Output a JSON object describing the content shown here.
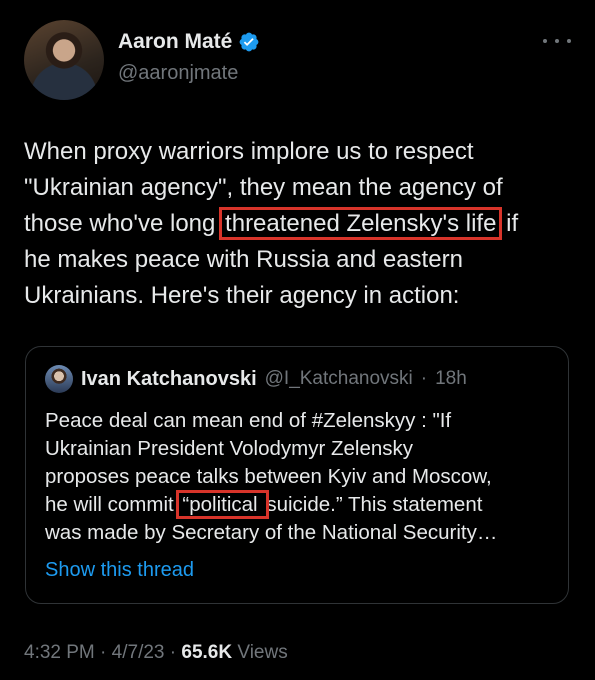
{
  "author": {
    "name": "Aaron Maté",
    "handle": "@aaronjmate",
    "verified": true,
    "avatar_icon": "avatar-photo"
  },
  "tweet": {
    "line1": "When proxy warriors implore us to respect",
    "line2": "\"Ukrainian agency\", they mean the agency of",
    "line3_pre": "those who've long ",
    "line3_hl": "threatened Zelensky's life",
    "line3_post": " if",
    "line4": "he makes peace with Russia and eastern",
    "line5": "Ukrainians. Here's their agency in action:",
    "highlight_color": "#d8342a"
  },
  "quoted": {
    "name": "Ivan Katchanovski",
    "handle": "@I_Katchanovski",
    "separator": "·",
    "time": "18h",
    "line1": "Peace deal can mean end of #Zelenskyy : \"If",
    "line2": "Ukrainian President Volodymyr Zelensky",
    "line3": "proposes peace talks between Kyiv and Moscow,",
    "line4_pre": "he will commit ",
    "line4_hl": "“political ",
    "line4_post": "suicide.” This statement",
    "line5": "was made by Secretary of the National Security…",
    "show_thread": "Show this thread"
  },
  "meta": {
    "time": "4:32 PM",
    "sep1": "·",
    "date": "4/7/23",
    "sep2": "·",
    "views_count": "65.6K",
    "views_label": "Views"
  },
  "colors": {
    "background": "#000000",
    "text": "#e7e9ea",
    "muted": "#71767b",
    "link": "#1d9bf0",
    "verified": "#1d9bf0"
  }
}
